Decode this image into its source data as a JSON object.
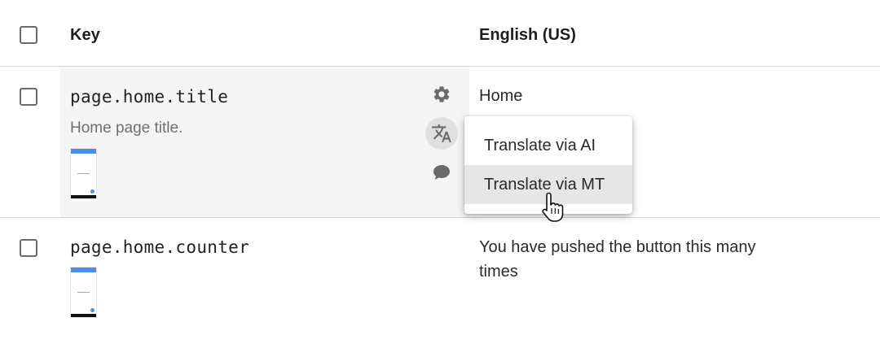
{
  "table": {
    "header": {
      "key_label": "Key",
      "language_label": "English (US)"
    },
    "rows": [
      {
        "key": "page.home.title",
        "description": "Home page title.",
        "value": "Home",
        "icons": [
          "gear-icon",
          "translate-icon",
          "comment-icon"
        ]
      },
      {
        "key": "page.home.counter",
        "value_line1": "You have pushed the button this many",
        "value_line2": "times"
      }
    ]
  },
  "menu": {
    "items": [
      {
        "label": "Translate via AI"
      },
      {
        "label": "Translate via MT"
      }
    ]
  },
  "colors": {
    "row_highlight": "#f5f5f5",
    "menu_hover": "#e6e6e6",
    "thumb_accent": "#4a8fe7"
  }
}
